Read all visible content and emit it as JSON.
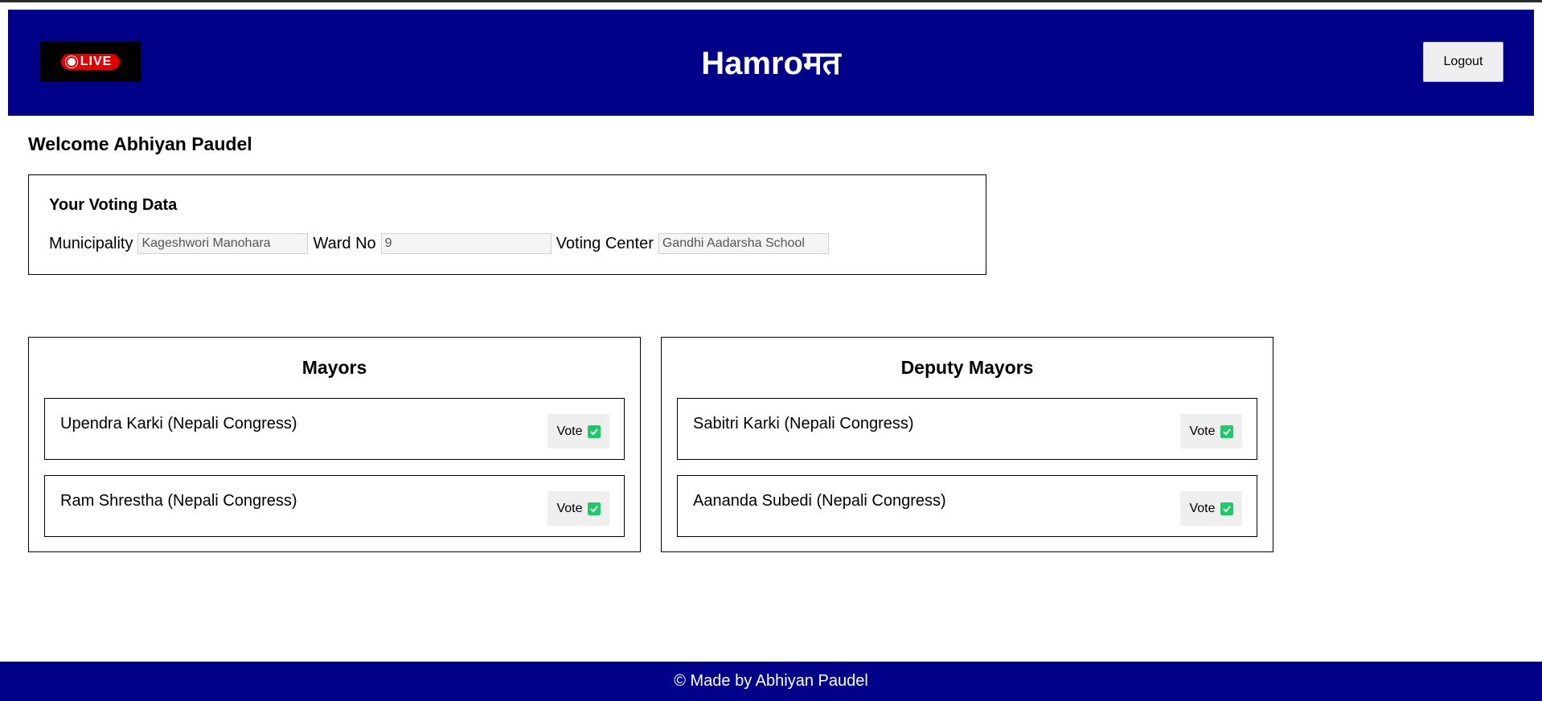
{
  "header": {
    "live_label": "LIVE",
    "title": "Hamroमत",
    "logout_label": "Logout"
  },
  "welcome": "Welcome Abhiyan Paudel",
  "voting_data": {
    "heading": "Your Voting Data",
    "municipality_label": "Municipality",
    "municipality_value": "Kageshwori Manohara",
    "ward_label": "Ward No",
    "ward_value": "9",
    "center_label": "Voting Center",
    "center_value": "Gandhi Aadarsha School"
  },
  "mayors": {
    "heading": "Mayors",
    "candidates": [
      {
        "name": "Upendra Karki (Nepali Congress)",
        "vote_label": "Vote"
      },
      {
        "name": "Ram Shrestha (Nepali Congress)",
        "vote_label": "Vote"
      }
    ]
  },
  "deputy_mayors": {
    "heading": "Deputy Mayors",
    "candidates": [
      {
        "name": "Sabitri Karki (Nepali Congress)",
        "vote_label": "Vote"
      },
      {
        "name": "Aananda Subedi (Nepali Congress)",
        "vote_label": "Vote"
      }
    ]
  },
  "footer": "© Made by Abhiyan Paudel",
  "colors": {
    "header_bg": "#000088",
    "live_red": "#e00000",
    "check_green": "#1ec96a"
  }
}
